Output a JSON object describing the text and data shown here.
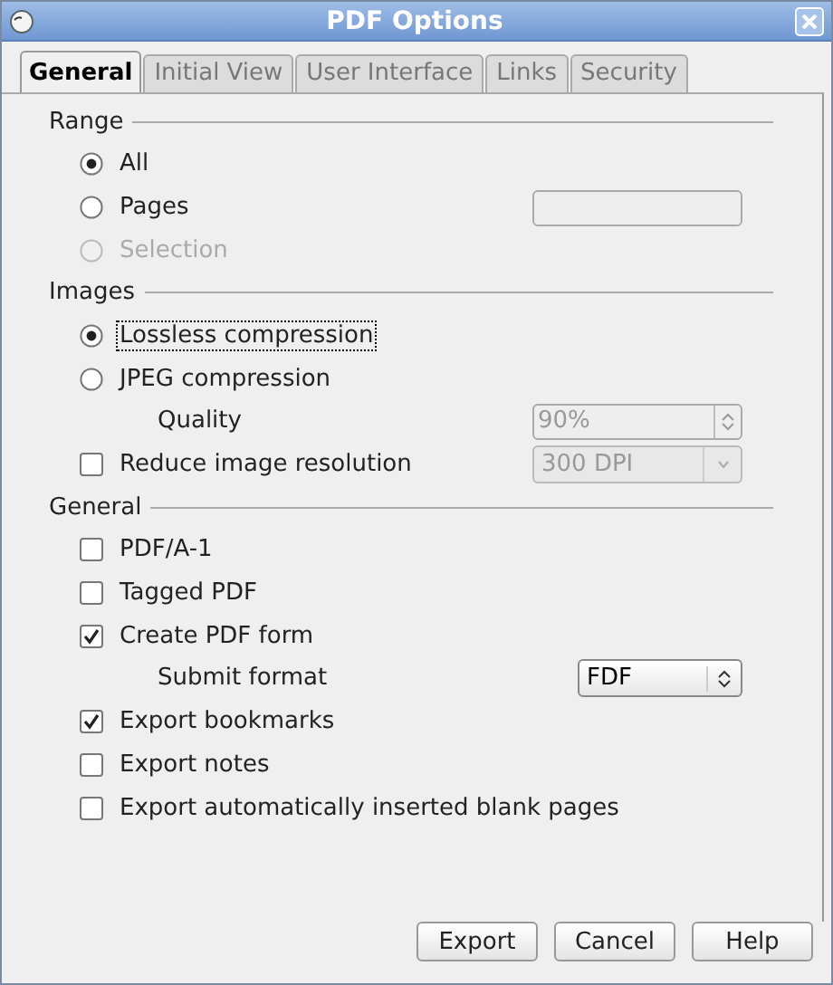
{
  "window": {
    "title": "PDF Options"
  },
  "tabs": [
    {
      "label": "General",
      "selected": true
    },
    {
      "label": "Initial View",
      "selected": false
    },
    {
      "label": "User Interface",
      "selected": false
    },
    {
      "label": "Links",
      "selected": false
    },
    {
      "label": "Security",
      "selected": false
    }
  ],
  "sections": [
    {
      "title": "Range",
      "items": [
        {
          "kind": "radio",
          "label": "All",
          "selected": true,
          "disabled": false,
          "focused": false
        },
        {
          "kind": "radio",
          "label": "Pages",
          "selected": false,
          "disabled": false,
          "focused": false,
          "control": {
            "kind": "field",
            "disabled": true
          }
        },
        {
          "kind": "radio",
          "label": "Selection",
          "selected": false,
          "disabled": true,
          "focused": false
        }
      ]
    },
    {
      "title": "Images",
      "items": [
        {
          "kind": "radio",
          "label": "Lossless compression",
          "selected": true,
          "disabled": false,
          "focused": true
        },
        {
          "kind": "radio",
          "label": "JPEG compression",
          "selected": false,
          "disabled": false,
          "focused": false
        },
        {
          "kind": "sublabel",
          "label": "Quality",
          "disabled": false,
          "control": {
            "kind": "spin",
            "value": "90%",
            "disabled": true
          }
        },
        {
          "kind": "checkbox",
          "label": "Reduce image resolution",
          "checked": false,
          "disabled": false,
          "focused": false,
          "control": {
            "kind": "dropdown",
            "value": "300 DPI",
            "disabled": true
          }
        }
      ]
    },
    {
      "title": "General",
      "items": [
        {
          "kind": "checkbox",
          "label": "PDF/A-1",
          "checked": false,
          "disabled": false,
          "focused": false
        },
        {
          "kind": "checkbox",
          "label": "Tagged PDF",
          "checked": false,
          "disabled": false,
          "focused": false
        },
        {
          "kind": "checkbox",
          "label": "Create PDF form",
          "checked": true,
          "disabled": false,
          "focused": false
        },
        {
          "kind": "sublabel",
          "label": "Submit format",
          "disabled": false,
          "control": {
            "kind": "select",
            "value": "FDF",
            "disabled": false
          }
        },
        {
          "kind": "checkbox",
          "label": "Export bookmarks",
          "checked": true,
          "disabled": false,
          "focused": false
        },
        {
          "kind": "checkbox",
          "label": "Export notes",
          "checked": false,
          "disabled": false,
          "focused": false
        },
        {
          "kind": "checkbox",
          "label": "Export automatically inserted blank pages",
          "checked": false,
          "disabled": false,
          "focused": false
        }
      ]
    }
  ],
  "buttons": [
    "Export",
    "Cancel",
    "Help"
  ]
}
